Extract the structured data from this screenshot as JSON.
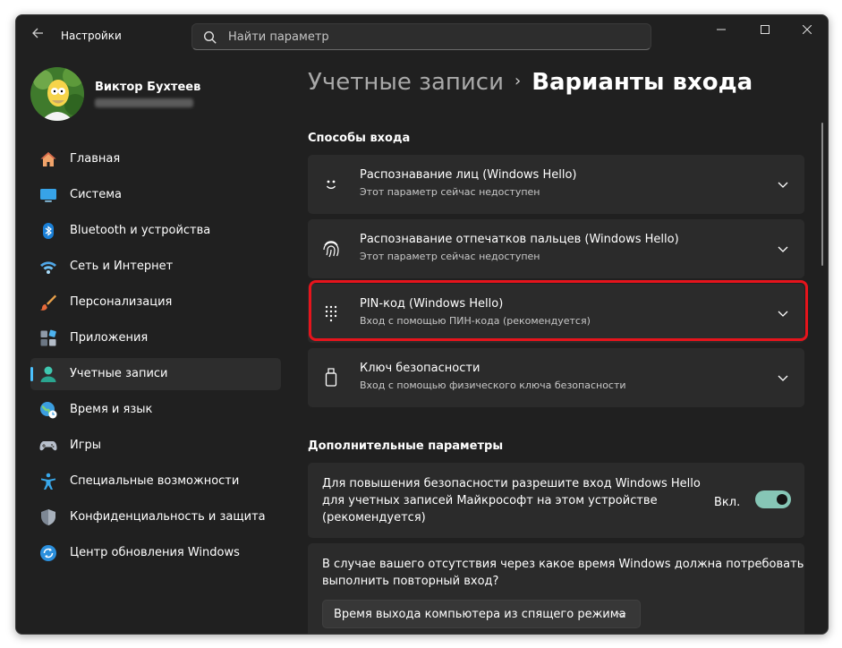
{
  "app": {
    "title": "Настройки"
  },
  "search": {
    "placeholder": "Найти параметр"
  },
  "user": {
    "name": "Виктор Бухтеев"
  },
  "nav": {
    "items": [
      {
        "label": "Главная",
        "icon": "home-icon"
      },
      {
        "label": "Система",
        "icon": "monitor-icon"
      },
      {
        "label": "Bluetooth и устройства",
        "icon": "bluetooth-icon"
      },
      {
        "label": "Сеть и Интернет",
        "icon": "wifi-icon"
      },
      {
        "label": "Персонализация",
        "icon": "brush-icon"
      },
      {
        "label": "Приложения",
        "icon": "apps-icon"
      },
      {
        "label": "Учетные записи",
        "icon": "person-icon",
        "active": true
      },
      {
        "label": "Время и язык",
        "icon": "globe-icon"
      },
      {
        "label": "Игры",
        "icon": "gamepad-icon"
      },
      {
        "label": "Специальные возможности",
        "icon": "accessibility-icon"
      },
      {
        "label": "Конфиденциальность и защита",
        "icon": "shield-icon"
      },
      {
        "label": "Центр обновления Windows",
        "icon": "update-icon"
      }
    ]
  },
  "breadcrumb": {
    "parent": "Учетные записи",
    "separator": "›",
    "current": "Варианты входа"
  },
  "signin": {
    "header": "Способы входа",
    "options": [
      {
        "title": "Распознавание лиц (Windows Hello)",
        "subtitle": "Этот параметр сейчас недоступен",
        "icon": "face-icon"
      },
      {
        "title": "Распознавание отпечатков пальцев (Windows Hello)",
        "subtitle": "Этот параметр сейчас недоступен",
        "icon": "fingerprint-icon"
      },
      {
        "title": "PIN-код (Windows Hello)",
        "subtitle": "Вход с помощью ПИН-кода (рекомендуется)",
        "icon": "keypad-icon",
        "highlighted": true
      },
      {
        "title": "Ключ безопасности",
        "subtitle": "Вход с помощью физического ключа безопасности",
        "icon": "usb-key-icon"
      }
    ]
  },
  "additional": {
    "header": "Дополнительные параметры",
    "hello_only": {
      "line1": "Для повышения безопасности разрешите вход Windows Hello",
      "line2": "для учетных записей Майкрософт на этом устройстве",
      "line3": "(рекомендуется)",
      "toggle_label": "Вкл.",
      "toggle_on": true
    },
    "require_signin": {
      "line1": "В случае вашего отсутствия через какое время Windows должна потребовать",
      "line2": "выполнить повторный вход?",
      "dropdown_value": "Время выхода компьютера из спящего режима"
    }
  },
  "colors": {
    "accent": "#4cc2ff",
    "highlight": "#e6141c",
    "toggle": "#86c6b6",
    "background": "#202020",
    "card": "#2b2b2b"
  }
}
